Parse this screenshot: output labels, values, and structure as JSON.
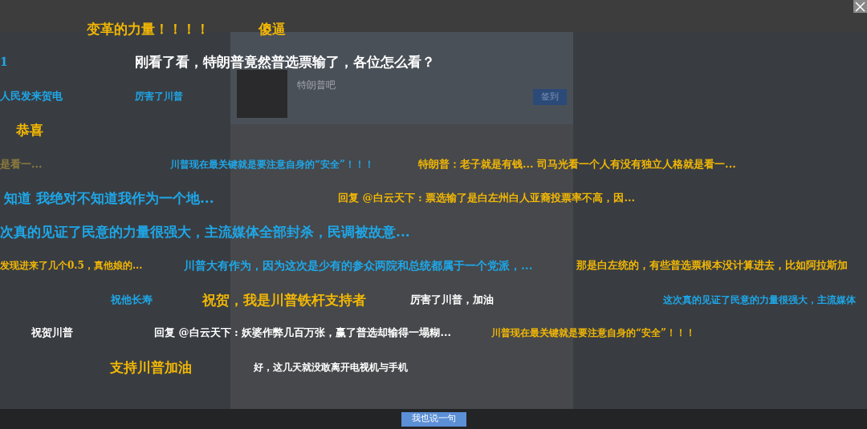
{
  "page": {
    "forum_name": "特朗普吧",
    "sign_in_button": "签到",
    "post_button": "我也说一句"
  },
  "comments": [
    {
      "text": "变革的力量！！！！",
      "color": "#f2b705"
    },
    {
      "text": "傻逼",
      "color": "#f2b705"
    },
    {
      "text": "1",
      "color": "#1ea7e8"
    },
    {
      "text": "刚看了看，特朗普竟然普选票输了，各位怎么看？",
      "color": "#ffffff"
    },
    {
      "text": "人民发来贺电",
      "color": "#1ea7e8"
    },
    {
      "text": "厉害了川普",
      "color": "#1ea7e8"
    },
    {
      "text": "恭喜",
      "color": "#f2b705"
    },
    {
      "text": "是看一...",
      "color": "#8c7a3c"
    },
    {
      "text": "川普现在最关键就是要注意自身的“安全”！！！",
      "color": "#1ea7e8"
    },
    {
      "text": "特朗普：老子就是有钱... 司马光看一个人有没有独立人格就是看一...",
      "color": "#f2b705"
    },
    {
      "text": "知道 我绝对不知道我作为一个地...",
      "color": "#1ea7e8"
    },
    {
      "text": "回复 @白云天下 : 票选输了是白左州白人亚裔投票率不高，因...",
      "color": "#f2b705"
    },
    {
      "text": "次真的见证了民意的力量很强大，主流媒体全部封杀，民调被故意...",
      "color": "#1ea7e8"
    },
    {
      "text": "发现进来了几个0.5，真他娘的...",
      "color": "#f2b705"
    },
    {
      "text": "川普大有作为，因为这次是少有的参众两院和总统都属于一个党派，...",
      "color": "#1ea7e8"
    },
    {
      "text": "那是白左统的，有些普选票根本没计算进去，比如阿拉斯加",
      "color": "#f2b705"
    },
    {
      "text": "祝他长寿",
      "color": "#1ea7e8"
    },
    {
      "text": "祝贺，我是川普铁杆支持者",
      "color": "#f2b705"
    },
    {
      "text": "厉害了川普，加油",
      "color": "#ffffff"
    },
    {
      "text": "这次真的见证了民意的力量很强大，主流媒体",
      "color": "#1ea7e8"
    },
    {
      "text": "祝贺川普",
      "color": "#ffffff"
    },
    {
      "text": "回复 @白云天下 : 妖婆作弊几百万张，赢了普选却输得一塌糊...",
      "color": "#ffffff"
    },
    {
      "text": "川普现在最关键就是要注意自身的“安全”！！！",
      "color": "#f2b705"
    },
    {
      "text": "支持川普加油",
      "color": "#f2b705"
    },
    {
      "text": "好，这几天就没敢离开电视机与手机",
      "color": "#ffffff"
    }
  ]
}
